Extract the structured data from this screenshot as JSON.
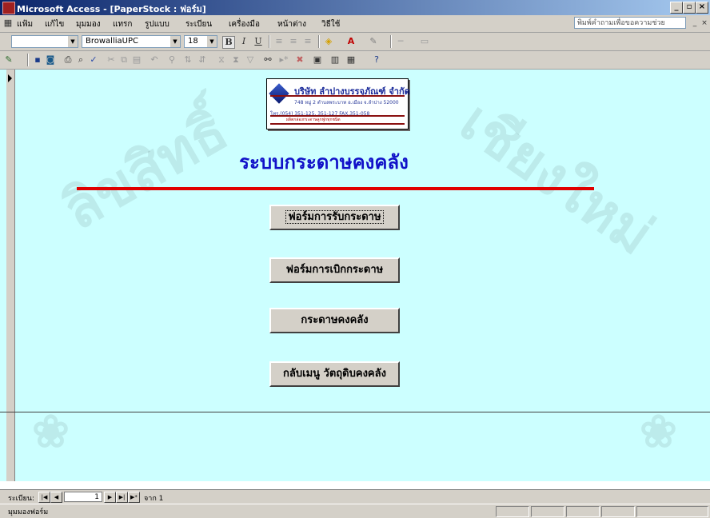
{
  "window": {
    "title": "Microsoft Access - [PaperStock : ฟอร์ม]",
    "minimize": "_",
    "restore": "▫",
    "close": "×"
  },
  "menu": {
    "items": [
      "แฟ้ม",
      "แก้ไข",
      "มุมมอง",
      "แทรก",
      "รูปแบบ",
      "ระเบียน",
      "เครื่องมือ",
      "หน้าต่าง",
      "วิธีใช้"
    ],
    "help_placeholder": "พิมพ์คำถามเพื่อขอความช่วย"
  },
  "format_toolbar": {
    "object_value": "",
    "font": "BrowalliaUPC",
    "size": "18",
    "bold": "B",
    "italic": "I",
    "underline": "U"
  },
  "logo": {
    "company": "บริษัท ลำปางบรรจุภัณฑ์ จำกัด",
    "address": "748 หมู่ 2 ตำบลพระบาท อ.เมือง จ.ลำปาง 52000",
    "phone": "โทร.(054) 351-125, 351-127  FAX.351-058",
    "slogan": "ผลิตกล่องกระดาษลูกฟูกทุกชนิด"
  },
  "form": {
    "heading": "ระบบกระดาษคงคลัง",
    "buttons": [
      "ฟอร์มการรับกระดาษ",
      "ฟอร์มการเบิกกระดาษ",
      "กระดาษคงคลัง",
      "กลับเมนู วัตถุดิบคงคลัง"
    ]
  },
  "record_nav": {
    "label": "ระเบียน:",
    "current": "1",
    "total_text": "จาก 1"
  },
  "status": {
    "text": "มุมมองฟอร์ม"
  },
  "watermark": {
    "text": "ลิขสิทธิ์มหาวิทยาลัยเชียงใหม่"
  },
  "colors": {
    "form_background": "#ccffff",
    "heading": "#1010c8",
    "rule": "#e00000",
    "titlebar": "#0a246a"
  }
}
